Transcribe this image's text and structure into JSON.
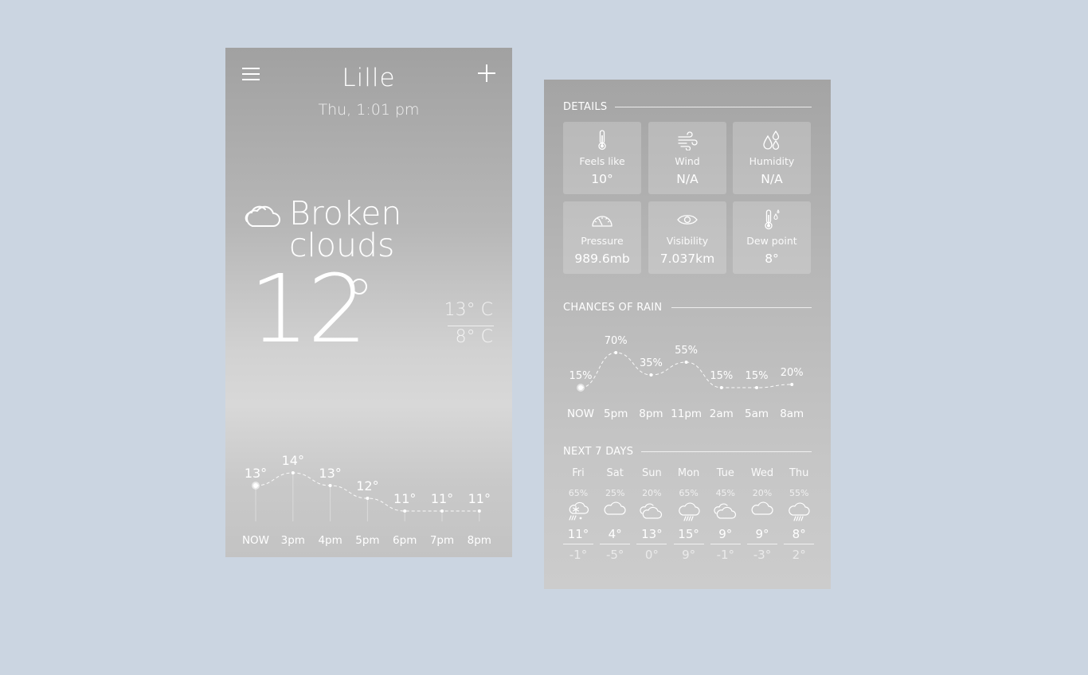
{
  "current": {
    "city": "Lille",
    "datetime": "Thu, 1:01 pm",
    "condition": "Broken clouds",
    "condition_line1": "Broken",
    "condition_line2": "clouds",
    "condition_icon": "cloud-icon",
    "temperature": "12",
    "high": "13° C",
    "low": "8° C"
  },
  "chart_data": [
    {
      "type": "line",
      "categories": [
        "NOW",
        "3pm",
        "4pm",
        "5pm",
        "6pm",
        "7pm",
        "8pm"
      ],
      "values": [
        13,
        14,
        13,
        12,
        11,
        11,
        11
      ],
      "labels": [
        "13°",
        "14°",
        "13°",
        "12°",
        "11°",
        "11°",
        "11°"
      ]
    },
    {
      "type": "line",
      "categories": [
        "NOW",
        "5pm",
        "8pm",
        "11pm",
        "2am",
        "5am",
        "8am"
      ],
      "values": [
        15,
        70,
        35,
        55,
        15,
        15,
        20
      ],
      "labels": [
        "15%",
        "70%",
        "35%",
        "55%",
        "15%",
        "15%",
        "20%"
      ]
    }
  ],
  "details": {
    "title": "DETAILS",
    "cards": [
      {
        "label": "Feels like",
        "value": "10°",
        "icon": "thermometer-icon"
      },
      {
        "label": "Wind",
        "value": "N/A",
        "icon": "wind-icon"
      },
      {
        "label": "Humidity",
        "value": "N/A",
        "icon": "humidity-icon"
      },
      {
        "label": "Pressure",
        "value": "989.6mb",
        "icon": "gauge-icon"
      },
      {
        "label": "Visibility",
        "value": "7.037km",
        "icon": "eye-icon"
      },
      {
        "label": "Dew point",
        "value": "8°",
        "icon": "dew-point-icon"
      }
    ]
  },
  "rain": {
    "title": "CHANCES OF RAIN"
  },
  "week": {
    "title": "NEXT 7 DAYS",
    "days": [
      {
        "name": "Fri",
        "pct": "65%",
        "icon": "snow-icon",
        "hi": "11°",
        "lo": "-1°"
      },
      {
        "name": "Sat",
        "pct": "25%",
        "icon": "cloud-icon",
        "hi": "4°",
        "lo": "-5°"
      },
      {
        "name": "Sun",
        "pct": "20%",
        "icon": "clouds-icon",
        "hi": "13°",
        "lo": "0°"
      },
      {
        "name": "Mon",
        "pct": "65%",
        "icon": "rain-icon",
        "hi": "15°",
        "lo": "9°"
      },
      {
        "name": "Tue",
        "pct": "45%",
        "icon": "clouds-icon",
        "hi": "9°",
        "lo": "-1°"
      },
      {
        "name": "Wed",
        "pct": "20%",
        "icon": "cloud-icon",
        "hi": "9°",
        "lo": "-3°"
      },
      {
        "name": "Thu",
        "pct": "55%",
        "icon": "rain-icon",
        "hi": "8°",
        "lo": "2°"
      }
    ]
  },
  "colors": {
    "page_background": "#cbd5e1",
    "text": "#ffffff"
  }
}
